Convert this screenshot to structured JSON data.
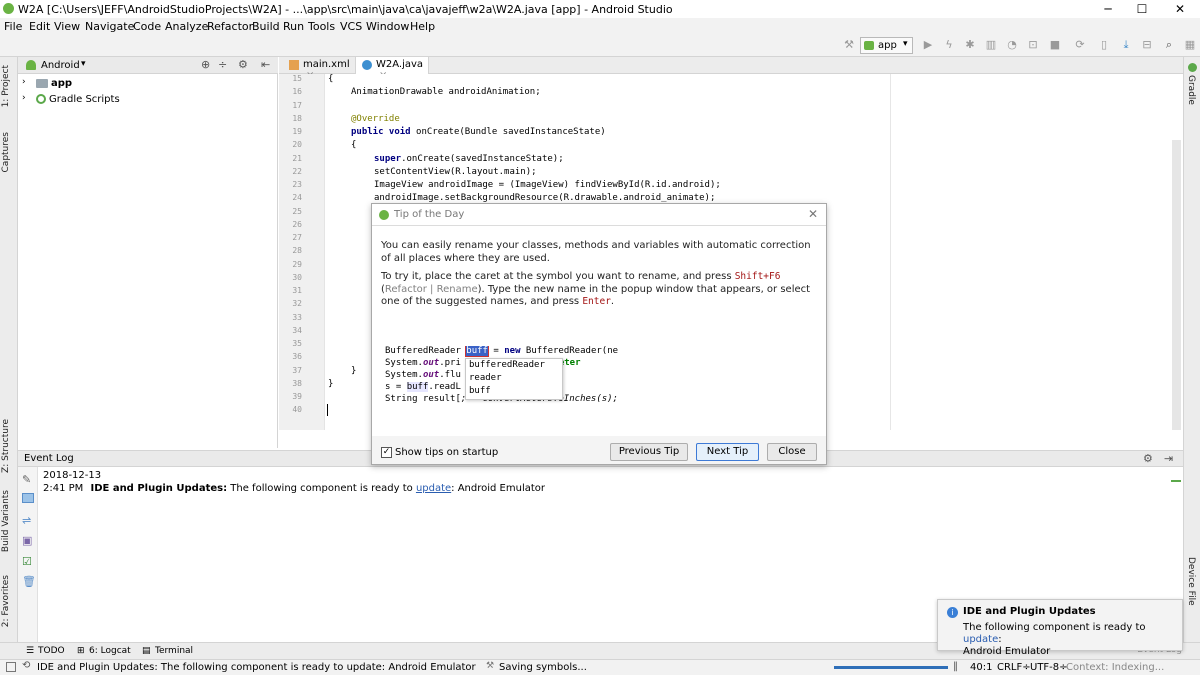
{
  "window": {
    "title": "W2A [C:\\Users\\JEFF\\AndroidStudioProjects\\W2A] - ...\\app\\src\\main\\java\\ca\\javajeff\\w2a\\W2A.java [app] - Android Studio"
  },
  "menu": [
    "File",
    "Edit",
    "View",
    "Navigate",
    "Code",
    "Analyze",
    "Refactor",
    "Build",
    "Run",
    "Tools",
    "VCS",
    "Window",
    "Help"
  ],
  "toolbar": {
    "config": "app"
  },
  "left_tabs": {
    "project": "1: Project",
    "captures": "Captures",
    "structure": "Z: Structure",
    "build_variants": "Build Variants",
    "favorites": "2: Favorites"
  },
  "right_tabs": {
    "gradle": "Gradle",
    "device_file": "Device File"
  },
  "project": {
    "view": "Android",
    "items": [
      "app",
      "Gradle Scripts"
    ]
  },
  "editor": {
    "tabs": [
      "main.xml",
      "W2A.java"
    ],
    "line_numbers": [
      "15",
      "16",
      "17",
      "18",
      "19",
      "20",
      "21",
      "22",
      "23",
      "24",
      "25",
      "26",
      "27",
      "28",
      "29",
      "30",
      "31",
      "32",
      "33",
      "34",
      "35",
      "36",
      "37",
      "38",
      "39",
      "40"
    ],
    "lines": [
      {
        "t": "{",
        "i": 0
      },
      {
        "t": "AnimationDrawable androidAnimation;",
        "i": 2
      },
      {
        "t": "",
        "i": 0
      },
      {
        "t": "@Override",
        "i": 2,
        "c": "ann"
      },
      {
        "t": "public void onCreate(Bundle savedInstanceState)",
        "i": 2,
        "kw": "public void"
      },
      {
        "t": "{",
        "i": 2
      },
      {
        "t": "super.onCreate(savedInstanceState);",
        "i": 4,
        "kw": "super"
      },
      {
        "t": "setContentView(R.layout.main);",
        "i": 4
      },
      {
        "t": "ImageView androidImage = (ImageView) findViewById(R.id.android);",
        "i": 4
      },
      {
        "t": "androidImage.setBackgroundResource(R.drawable.android_animate);",
        "i": 4
      },
      {
        "t": "",
        "i": 0
      },
      {
        "t": "",
        "i": 0
      },
      {
        "t": "",
        "i": 0
      },
      {
        "t": "",
        "i": 0
      },
      {
        "t": "",
        "i": 0
      },
      {
        "t": "",
        "i": 0
      },
      {
        "t": "",
        "i": 0
      },
      {
        "t": "",
        "i": 0
      },
      {
        "t": "",
        "i": 0
      },
      {
        "t": "",
        "i": 0
      },
      {
        "t": "",
        "i": 0
      },
      {
        "t": "",
        "i": 0
      },
      {
        "t": "}",
        "i": 2
      },
      {
        "t": "}",
        "i": 0
      },
      {
        "t": "",
        "i": 0
      }
    ]
  },
  "dialog": {
    "title": "Tip of the Day",
    "para1": "You can easily rename your classes, methods and variables with automatic correction of all places where they are used.",
    "p2a": "To try it, place the caret at the symbol you want to rename, and press ",
    "p2_key": "Shift+F6",
    "p2b": " (",
    "p2_menu": "Refactor | Rename",
    "p2c": "). Type the new name in the popup window that appears, or select one of the suggested names, and press ",
    "p2_enter": "Enter",
    "p2d": ".",
    "snippet": {
      "l1a": "BufferedReader ",
      "l1sel": "buff",
      "l1b": " = ",
      "l1kw": "new",
      "l1c": " BufferedReader(ne",
      "l2a": "System.",
      "l2b": "out",
      "l2c": ".pri",
      "l2d": "er of meter",
      "l3a": "System.",
      "l3b": "out",
      "l3c": ".flu",
      "l4a": "s = ",
      "l4b": "buff",
      "l4c": ".readL",
      "l5a": "String result[",
      "l5b": "; = convertMetersToInches(s);"
    },
    "suggestions": [
      "bufferedReader",
      "reader",
      "buff"
    ],
    "show_tips": "Show tips on startup",
    "show_tips_checked": true,
    "buttons": {
      "prev": "Previous Tip",
      "next": "Next Tip",
      "close": "Close"
    }
  },
  "event_log": {
    "title": "Event Log",
    "date": "2018-12-13",
    "time": "2:41 PM",
    "heading": "IDE and Plugin Updates:",
    "message": " The following component is ready to ",
    "link": "update",
    "tail": ": Android Emulator"
  },
  "bottom_tabs": [
    "TODO",
    "6: Logcat",
    "Terminal"
  ],
  "notification": {
    "title": "IDE and Plugin Updates",
    "body": "The following component is ready to ",
    "link": "update",
    "body2": ":",
    "body3": "Android Emulator",
    "behind": "Event Log"
  },
  "status": {
    "message": "IDE and Plugin Updates: The following component is ready to update: Android Emulator",
    "task": "Saving symbols...",
    "position": "40:1",
    "line_sep": "CRLF÷",
    "encoding": "UTF-8÷",
    "context": "Context: Indexing..."
  }
}
